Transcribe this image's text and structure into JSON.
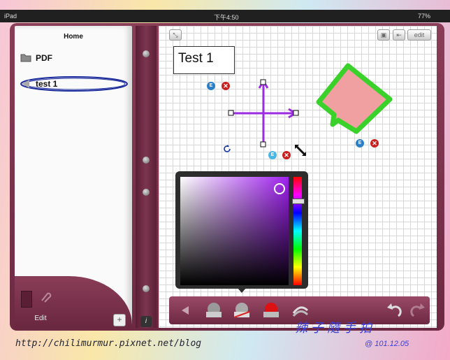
{
  "status_bar": {
    "device": "iPad",
    "time": "下午4:50",
    "battery": "77%"
  },
  "sidebar": {
    "title": "Home",
    "items": [
      {
        "label": "PDF",
        "icon": "folder-icon"
      },
      {
        "label": "test 1",
        "icon": "notebook-icon",
        "selected": true
      }
    ],
    "edit_label": "Edit",
    "add_label": "+"
  },
  "spine": {
    "info_label": "i"
  },
  "canvas": {
    "top_buttons": {
      "export_label": "⇤",
      "edit_label": "edit"
    },
    "text_box": "Test 1",
    "edit_badge": "E",
    "delete_badge": "✕",
    "shape_colors": {
      "fill": "#f0a0a0",
      "stroke": "#39d12a",
      "arrow": "#9b2be0"
    }
  },
  "color_picker": {
    "selected_color": "#a020f0"
  },
  "toolbar": {
    "tools": [
      "back-arrow-icon",
      "shape-gray-icon",
      "shape-red-outline-icon",
      "shape-red-fill-icon",
      "line-style-icon",
      "undo-icon",
      "redo-icon"
    ]
  },
  "footer": {
    "url": "http://chilimurmur.pixnet.net/blog",
    "signature": "辣子隨手拍",
    "date": "@ 101.12.05"
  }
}
